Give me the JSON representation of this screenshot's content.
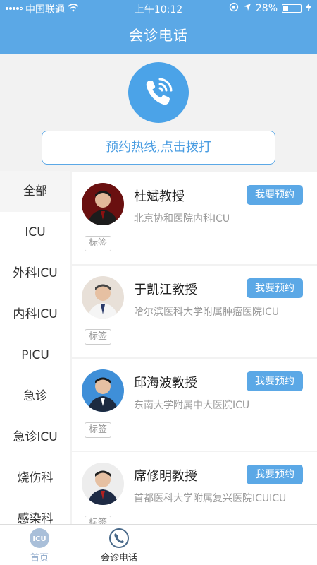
{
  "status_bar": {
    "carrier": "中国联通",
    "time": "上午10:12",
    "battery": "28%",
    "battery_level": 0.28
  },
  "nav": {
    "title": "会诊电话"
  },
  "hero": {
    "hotline_label": "预约热线,点击拨打",
    "icon": "phone-icon"
  },
  "sidebar": {
    "items": [
      {
        "label": "全部"
      },
      {
        "label": "ICU"
      },
      {
        "label": "外科ICU"
      },
      {
        "label": "内科ICU"
      },
      {
        "label": "PICU"
      },
      {
        "label": "急诊"
      },
      {
        "label": "急诊ICU"
      },
      {
        "label": "烧伤科"
      },
      {
        "label": "感染科"
      }
    ]
  },
  "doctors": [
    {
      "name": "杜斌教授",
      "hospital": "北京协和医院内科ICU",
      "button": "我要预约",
      "tag": "标签"
    },
    {
      "name": "于凯江教授",
      "hospital": "哈尔滨医科大学附属肿瘤医院ICU",
      "button": "我要预约",
      "tag": "标签"
    },
    {
      "name": "邱海波教授",
      "hospital": "东南大学附属中大医院ICU",
      "button": "我要预约",
      "tag": "标签"
    },
    {
      "name": "席修明教授",
      "hospital": "首都医科大学附属复兴医院ICUICU",
      "button": "我要预约",
      "tag": "标签"
    }
  ],
  "tabs": [
    {
      "label": "首页",
      "icon": "icu-icon"
    },
    {
      "label": "会诊电话",
      "icon": "phone-icon"
    }
  ],
  "colors": {
    "primary": "#5ba8e6",
    "accent": "#4ba3e8"
  }
}
